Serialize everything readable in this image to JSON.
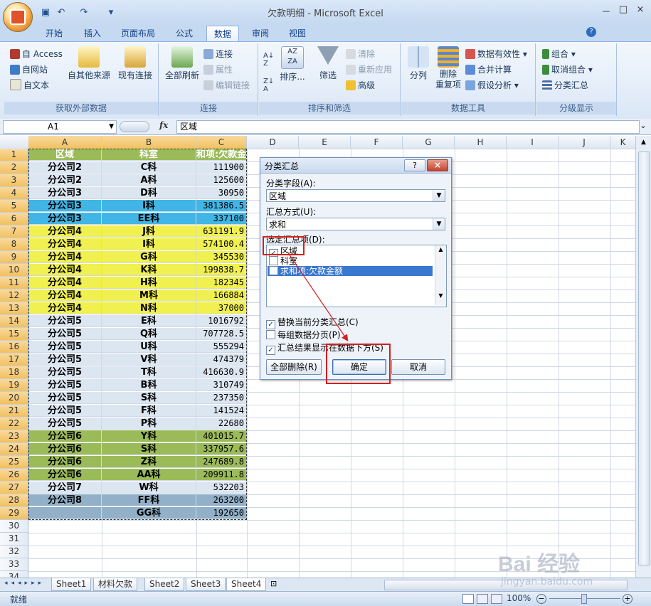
{
  "window": {
    "title": "欠款明细 - Microsoft Excel",
    "controls": [
      "－",
      "□",
      "×"
    ]
  },
  "tabs": [
    "开始",
    "插入",
    "页面布局",
    "公式",
    "数据",
    "审阅",
    "视图"
  ],
  "active_tab": "数据",
  "ribbon": {
    "groups": [
      {
        "label": "获取外部数据",
        "items": [
          "自 Access",
          "自网站",
          "自文本",
          "自其他来源",
          "现有连接"
        ]
      },
      {
        "label": "连接",
        "items": [
          "全部刷新",
          "连接",
          "属性",
          "编辑链接"
        ]
      },
      {
        "label": "排序和筛选",
        "items": [
          "排序...",
          "筛选",
          "清除",
          "重新应用",
          "高级"
        ]
      },
      {
        "label": "数据工具",
        "items": [
          "分列",
          "删除\n重复项",
          "数据有效性",
          "合并计算",
          "假设分析"
        ]
      },
      {
        "label": "分级显示",
        "items": [
          "组合",
          "取消组合",
          "分类汇总"
        ]
      }
    ]
  },
  "formula_bar": {
    "name_box": "A1",
    "fx": "fx",
    "content": "区域"
  },
  "sheet": {
    "columns": [
      "A",
      "B",
      "C",
      "D",
      "E",
      "F",
      "G",
      "H",
      "I",
      "J",
      "K"
    ],
    "header_row": [
      "区域",
      "科室",
      "和项:欠款金"
    ],
    "rows": [
      {
        "r": "2",
        "a": "分公司2",
        "b": "C科",
        "c": "111900",
        "color": "#dce6f1"
      },
      {
        "r": "3",
        "a": "分公司2",
        "b": "A科",
        "c": "125600",
        "color": "#dce6f1"
      },
      {
        "r": "4",
        "a": "分公司3",
        "b": "D科",
        "c": "30950",
        "color": "#dce6f1"
      },
      {
        "r": "5",
        "a": "分公司3",
        "b": "I科",
        "c": "381386.5",
        "color": "#41b6e6"
      },
      {
        "r": "6",
        "a": "分公司3",
        "b": "EE科",
        "c": "337100",
        "color": "#41b6e6"
      },
      {
        "r": "7",
        "a": "分公司4",
        "b": "J科",
        "c": "631191.9",
        "color": "#f0f050"
      },
      {
        "r": "8",
        "a": "分公司4",
        "b": "I科",
        "c": "574100.4",
        "color": "#f0f050"
      },
      {
        "r": "9",
        "a": "分公司4",
        "b": "G科",
        "c": "345530",
        "color": "#f0f050"
      },
      {
        "r": "10",
        "a": "分公司4",
        "b": "K科",
        "c": "199838.7",
        "color": "#f0f050"
      },
      {
        "r": "11",
        "a": "分公司4",
        "b": "H科",
        "c": "182345",
        "color": "#f0f050"
      },
      {
        "r": "12",
        "a": "分公司4",
        "b": "M科",
        "c": "166884",
        "color": "#f0f050"
      },
      {
        "r": "13",
        "a": "分公司4",
        "b": "N科",
        "c": "37000",
        "color": "#f0f050"
      },
      {
        "r": "14",
        "a": "分公司5",
        "b": "E科",
        "c": "1016792",
        "color": "#dce6f1"
      },
      {
        "r": "15",
        "a": "分公司5",
        "b": "Q科",
        "c": "707728.5",
        "color": "#dce6f1"
      },
      {
        "r": "16",
        "a": "分公司5",
        "b": "U科",
        "c": "555294",
        "color": "#dce6f1"
      },
      {
        "r": "17",
        "a": "分公司5",
        "b": "V科",
        "c": "474379",
        "color": "#dce6f1"
      },
      {
        "r": "18",
        "a": "分公司5",
        "b": "T科",
        "c": "416630.9",
        "color": "#dce6f1"
      },
      {
        "r": "19",
        "a": "分公司5",
        "b": "B科",
        "c": "310749",
        "color": "#dce6f1"
      },
      {
        "r": "20",
        "a": "分公司5",
        "b": "S科",
        "c": "237350",
        "color": "#dce6f1"
      },
      {
        "r": "21",
        "a": "分公司5",
        "b": "F科",
        "c": "141524",
        "color": "#dce6f1"
      },
      {
        "r": "22",
        "a": "分公司5",
        "b": "P科",
        "c": "22680",
        "color": "#dce6f1"
      },
      {
        "r": "23",
        "a": "分公司6",
        "b": "Y科",
        "c": "401015.7",
        "color": "#9bbb59"
      },
      {
        "r": "24",
        "a": "分公司6",
        "b": "S科",
        "c": "337957.6",
        "color": "#9bbb59"
      },
      {
        "r": "25",
        "a": "分公司6",
        "b": "Z科",
        "c": "247689.8",
        "color": "#9bbb59"
      },
      {
        "r": "26",
        "a": "分公司6",
        "b": "AA科",
        "c": "209911.8",
        "color": "#9bbb59"
      },
      {
        "r": "27",
        "a": "分公司7",
        "b": "W科",
        "c": "532203",
        "color": "#dce6f1"
      },
      {
        "r": "28",
        "a": "分公司8",
        "b": "FF科",
        "c": "263200",
        "color": "#92b1c8"
      },
      {
        "r": "29",
        "a": "",
        "b": "GG科",
        "c": "192650",
        "color": "#92b1c8"
      }
    ],
    "empty_rows": [
      "30",
      "31",
      "32",
      "33",
      "34"
    ]
  },
  "dialog": {
    "title": "分类汇总",
    "field_label": "分类字段(A):",
    "field_value": "区域",
    "method_label": "汇总方式(U):",
    "method_value": "求和",
    "items_label": "选定汇总项(D):",
    "items": [
      {
        "label": "区域",
        "checked": true
      },
      {
        "label": "科室",
        "checked": false
      },
      {
        "label": "求和项:欠款金额",
        "checked": false
      }
    ],
    "options": [
      {
        "label": "替换当前分类汇总(C)",
        "checked": true
      },
      {
        "label": "每组数据分页(P)",
        "checked": false
      },
      {
        "label": "汇总结果显示在数据下方(S)",
        "checked": true
      }
    ],
    "btn_delete": "全部删除(R)",
    "btn_ok": "确定",
    "btn_cancel": "取消",
    "help": "?",
    "close": "×"
  },
  "sheet_tabs": [
    "Sheet1",
    "材料欠款",
    "Sheet2",
    "Sheet3",
    "Sheet4"
  ],
  "active_sheet": "Sheet4",
  "status": {
    "ready": "就绪",
    "zoom": "100%"
  },
  "watermark": {
    "text": "Bai 经验",
    "url": "jingyan.baidu.com"
  },
  "colors": {
    "header_fill": "#9bbb59",
    "accent": "#d21f1f"
  }
}
